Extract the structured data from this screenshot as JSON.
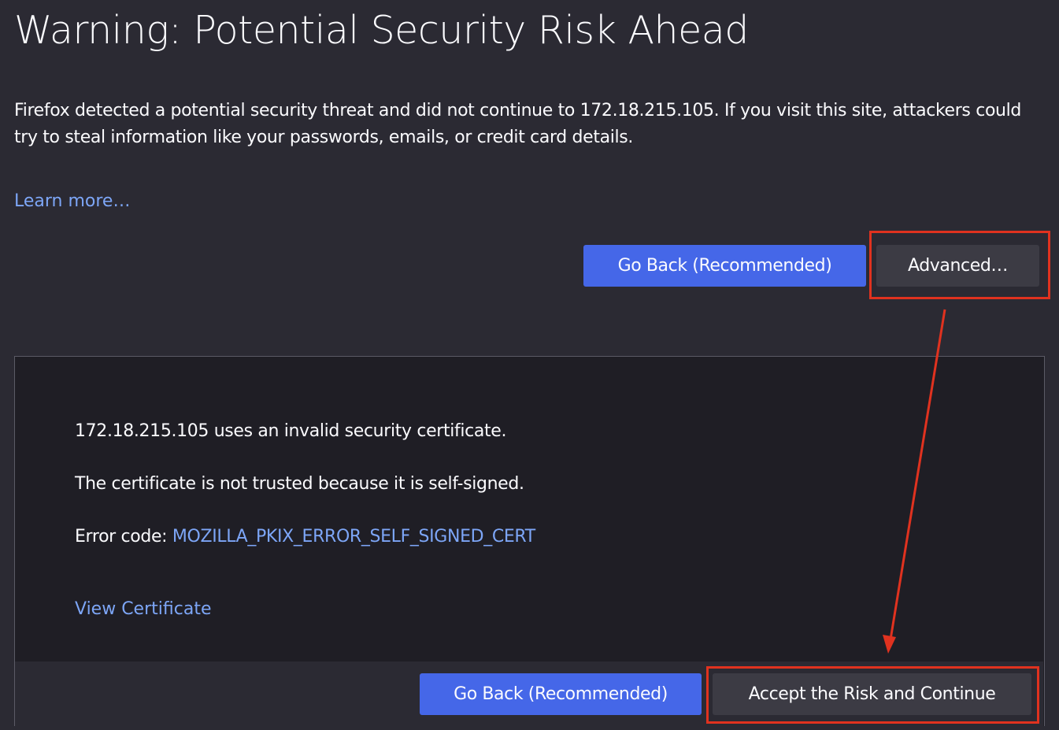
{
  "header": {
    "title": "Warning: Potential Security Risk Ahead"
  },
  "intro": {
    "text": "Firefox detected a potential security threat and did not continue to 172.18.215.105. If you visit this site, attackers could try to steal information like your passwords, emails, or credit card details."
  },
  "learn_more": {
    "label": "Learn more…"
  },
  "actions": {
    "go_back_label": "Go Back (Recommended)",
    "advanced_label": "Advanced…"
  },
  "advanced_panel": {
    "invalid_cert_text": "172.18.215.105 uses an invalid security certificate.",
    "not_trusted_text": "The certificate is not trusted because it is self-signed.",
    "error_code_label": "Error code: ",
    "error_code": "MOZILLA_PKIX_ERROR_SELF_SIGNED_CERT",
    "view_certificate_label": "View Certificate",
    "go_back_label": "Go Back (Recommended)",
    "accept_label": "Accept the Risk and Continue"
  },
  "annotations": {
    "highlight_color": "#e0321f"
  },
  "theme": {
    "background": "#2b2a33",
    "panel_background": "#1f1e25",
    "primary_button": "#4567e8",
    "secondary_button": "#3c3b44",
    "link_color": "#7da6f7"
  }
}
